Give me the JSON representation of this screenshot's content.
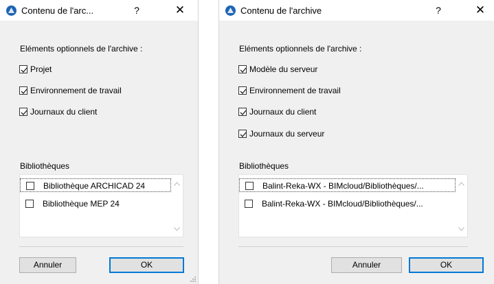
{
  "dialogs": [
    {
      "title": "Contenu de l'arc...",
      "help": "?",
      "close": "✕",
      "options_label": "Eléments optionnels de l'archive :",
      "options": [
        {
          "label": "Projet",
          "checked": true
        },
        {
          "label": "Environnement de travail",
          "checked": true
        },
        {
          "label": "Journaux du client",
          "checked": true
        }
      ],
      "libraries_label": "Bibliothèques",
      "libraries": [
        {
          "label": "Bibliothèque ARCHICAD 24",
          "checked": false
        },
        {
          "label": "Bibliothèque MEP 24",
          "checked": false
        }
      ],
      "cancel": "Annuler",
      "ok": "OK"
    },
    {
      "title": "Contenu de l'archive",
      "help": "?",
      "close": "✕",
      "options_label": "Eléments optionnels de l'archive :",
      "options": [
        {
          "label": "Modèle du serveur",
          "checked": true
        },
        {
          "label": "Environnement de travail",
          "checked": true
        },
        {
          "label": "Journaux du client",
          "checked": true
        },
        {
          "label": "Journaux du serveur",
          "checked": true
        }
      ],
      "libraries_label": "Bibliothèques",
      "libraries": [
        {
          "label": "Balint-Reka-WX - BIMcloud/Bibliothèques/...",
          "checked": false
        },
        {
          "label": "Balint-Reka-WX - BIMcloud/Bibliothèques/...",
          "checked": false
        }
      ],
      "cancel": "Annuler",
      "ok": "OK"
    }
  ],
  "colors": {
    "accent": "#0078d7",
    "dialog_bg": "#f0f0f0"
  }
}
